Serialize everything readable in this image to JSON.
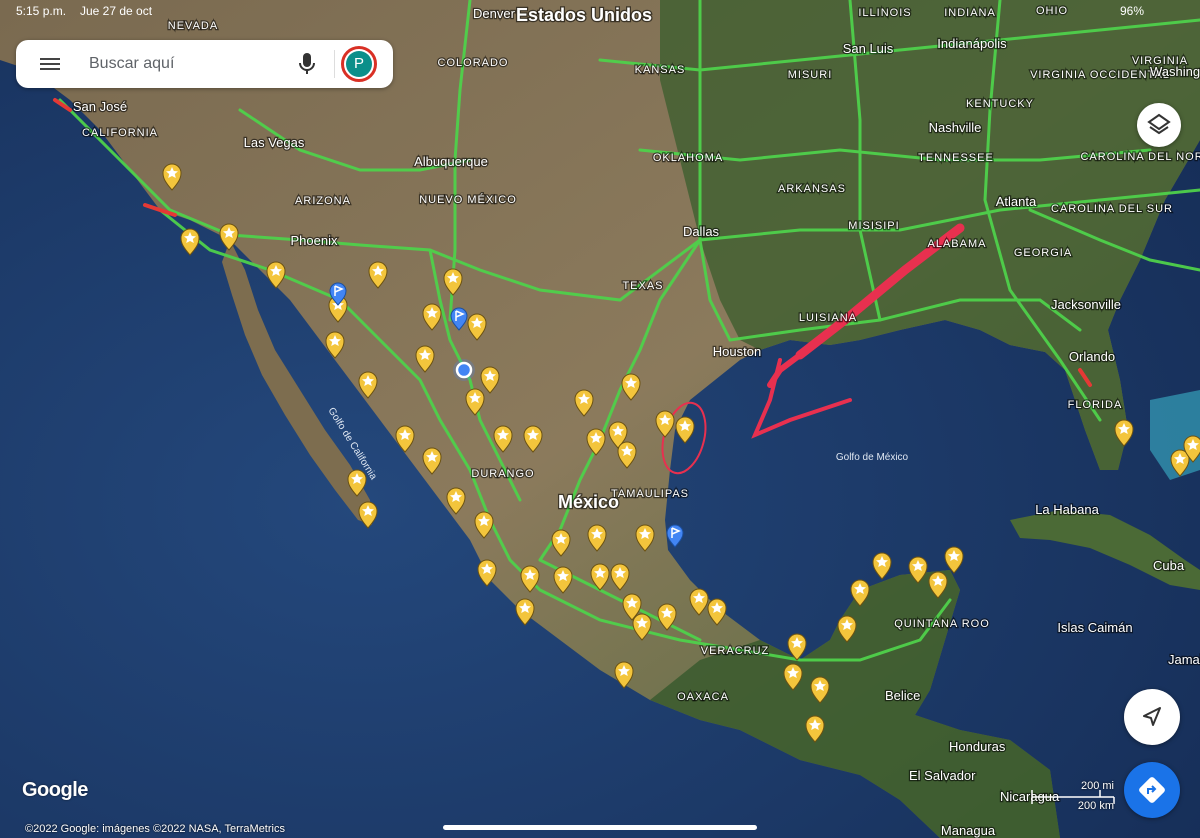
{
  "status_bar": {
    "time": "5:15 p.m.",
    "date": "Jue 27 de oct",
    "battery": "96%"
  },
  "search": {
    "placeholder": "Buscar aquí",
    "avatar_letter": "P"
  },
  "map_labels": {
    "countries": [
      "Estados Unidos",
      "México",
      "Belice",
      "Honduras",
      "El Salvador",
      "Nicaragua",
      "Cuba"
    ],
    "states": [
      "NEVADA",
      "COLORADO",
      "CALIFORNIA",
      "ARIZONA",
      "NUEVO MÉXICO",
      "KANSAS",
      "MISURI",
      "OKLAHOMA",
      "ARKANSAS",
      "TEXAS",
      "MISISIPI",
      "LUISIANA",
      "ALABAMA",
      "GEORGIA",
      "TENNESSEE",
      "KENTUCKY",
      "ILLINOIS",
      "INDIANA",
      "OHIO",
      "VIRGINIA OCCIDENTAL",
      "VIRGINIA",
      "CAROLINA DEL NORTE",
      "CAROLINA DEL SUR",
      "FLORIDA",
      "DURANGO",
      "TAMAULIPAS",
      "VERACRUZ",
      "OAXACA",
      "QUINTANA ROO"
    ],
    "cities": [
      "Denver",
      "San Luis",
      "Indianápolis",
      "Washington",
      "San José",
      "Las Vegas",
      "Albuquerque",
      "Nashville",
      "Phoenix",
      "Dallas",
      "Atlanta",
      "Houston",
      "Jacksonville",
      "Orlando",
      "La Habana",
      "Islas Caimán",
      "Jamaica",
      "Managua"
    ],
    "water": [
      "Golfo de California",
      "Golfo de México"
    ]
  },
  "icons": {
    "menu": "menu-icon",
    "mic": "microphone-icon",
    "layers": "layers-icon",
    "locate": "navigation-arrow-icon",
    "directions": "directions-icon",
    "saved_place": "star-pin-icon",
    "flag": "flag-pin-icon",
    "my_location": "blue-dot-icon"
  },
  "colors": {
    "traffic_green": "#4fd14b",
    "traffic_red": "#e53935",
    "pin_gold": "#f3c53c",
    "pin_blue": "#4285f4",
    "annotation_red": "#e8304f",
    "directions_blue": "#1a73e8"
  },
  "scale": {
    "miles": "200 mi",
    "km": "200 km"
  },
  "branding": {
    "logo": "Google",
    "attribution": "©2022 Google: imágenes ©2022 NASA, TerraMetrics"
  }
}
